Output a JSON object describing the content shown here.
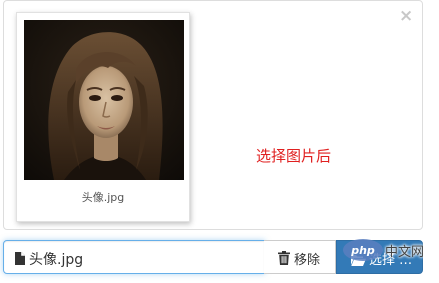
{
  "preview": {
    "close_glyph": "×",
    "thumbnail": {
      "caption": "头像.jpg"
    },
    "status_note": "选择图片后"
  },
  "input_group": {
    "caption_value": "头像.jpg",
    "remove_label": "移除",
    "browse_label": "选择 …"
  },
  "watermark": {
    "text": "php中文网"
  },
  "colors": {
    "accent_blue": "#337ab7",
    "focus_border": "#66afe9",
    "note_red": "#e02020"
  },
  "icons": {
    "file": "file-icon",
    "trash": "trash-icon",
    "folder": "folder-open-icon",
    "close": "close-icon"
  }
}
